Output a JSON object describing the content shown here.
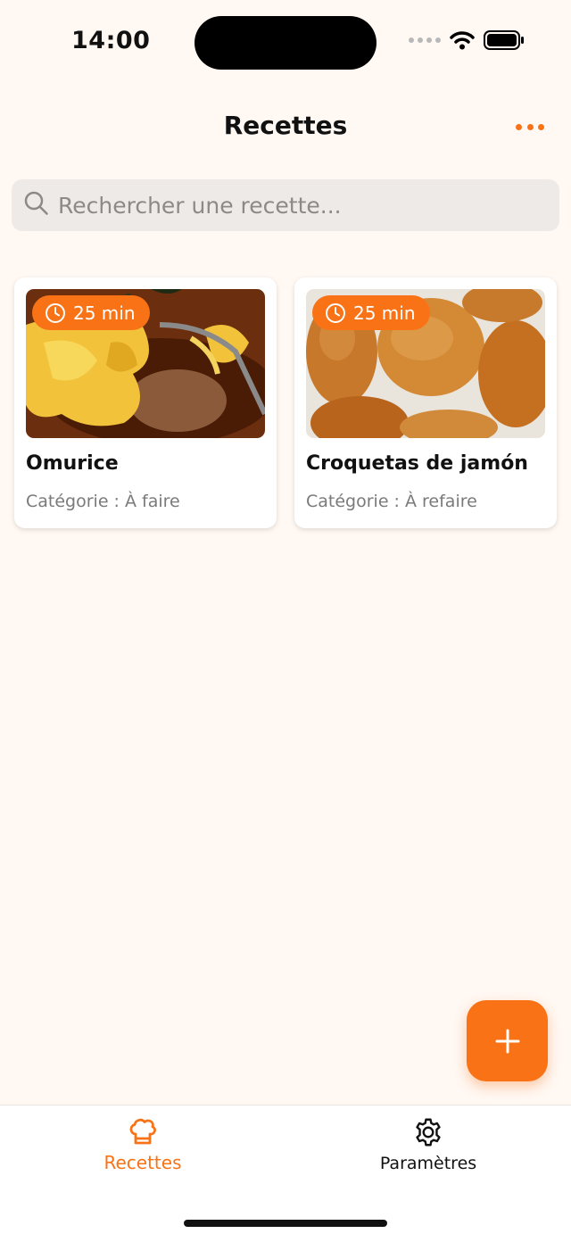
{
  "status_bar": {
    "time": "14:00"
  },
  "header": {
    "title": "Recettes"
  },
  "search": {
    "placeholder": "Rechercher une recette..."
  },
  "recipes": [
    {
      "title": "Omurice",
      "duration": "25 min",
      "category": "Catégorie : À faire"
    },
    {
      "title": "Croquetas de jamón",
      "duration": "25 min",
      "category": "Catégorie : À refaire"
    }
  ],
  "tabs": [
    {
      "label": "Recettes",
      "icon": "chef-hat-icon",
      "active": true
    },
    {
      "label": "Paramètres",
      "icon": "gear-icon",
      "active": false
    }
  ],
  "colors": {
    "accent": "#F97316",
    "background": "#FFF8F3",
    "search_bg": "#EEEAE7"
  }
}
